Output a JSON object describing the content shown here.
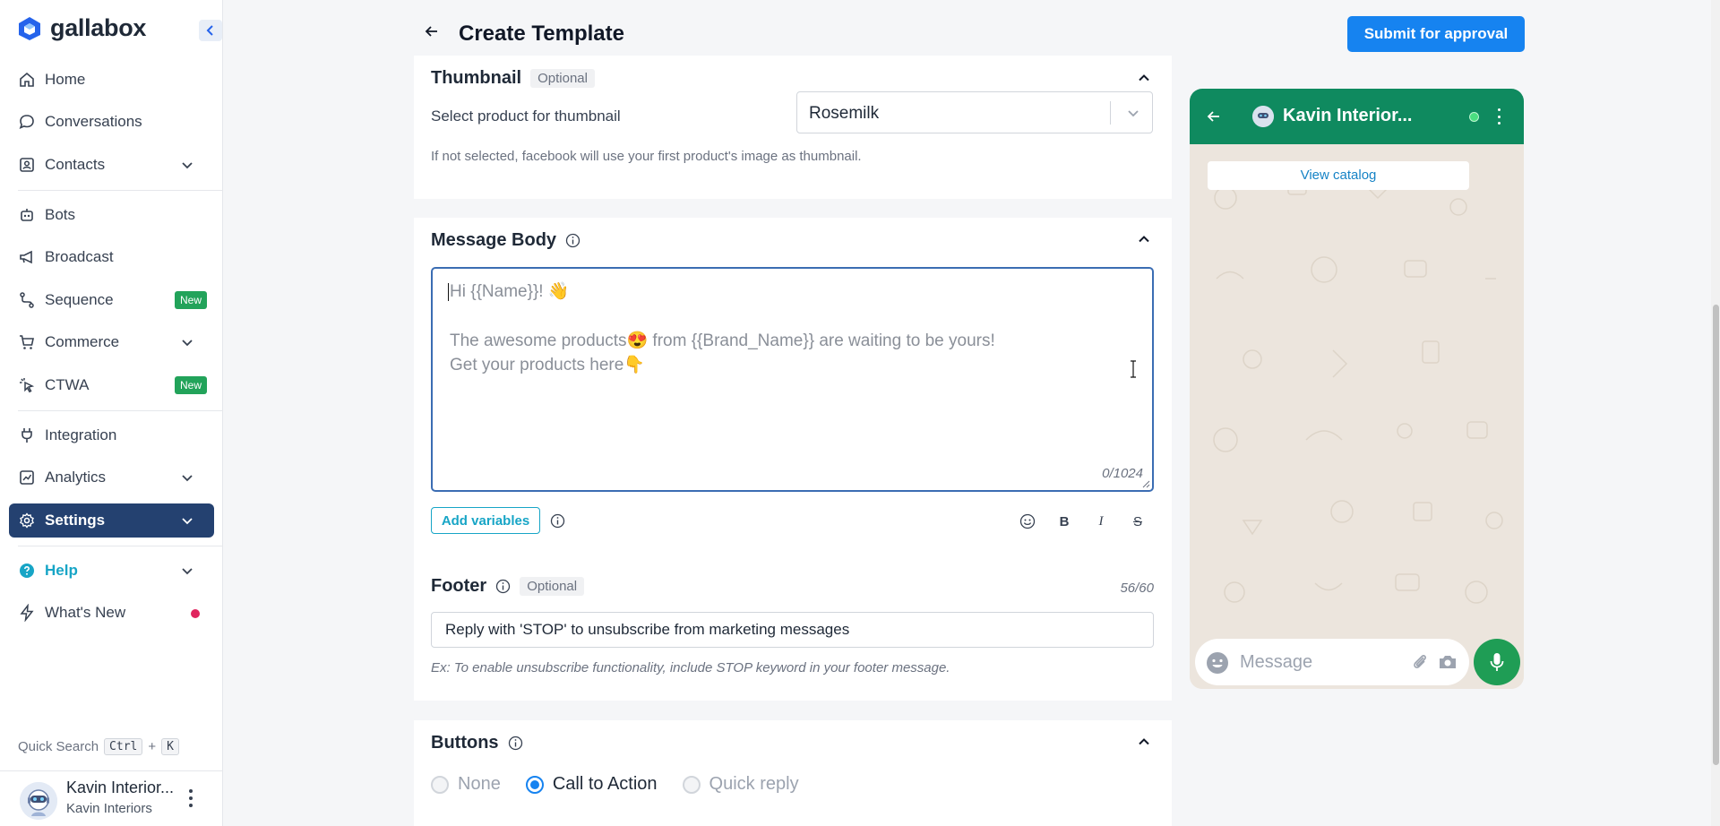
{
  "brand": {
    "name": "gallabox",
    "accent": "#1683f0",
    "logo_icon": "hexagon-cube-icon"
  },
  "sidebar": {
    "items": [
      {
        "label": "Home",
        "icon": "home-icon"
      },
      {
        "label": "Conversations",
        "icon": "chat-bubble-icon"
      },
      {
        "label": "Contacts",
        "icon": "contact-card-icon",
        "expandable": true
      },
      {
        "label": "Bots",
        "icon": "robot-icon"
      },
      {
        "label": "Broadcast",
        "icon": "megaphone-icon"
      },
      {
        "label": "Sequence",
        "icon": "flow-icon",
        "badge": "New"
      },
      {
        "label": "Commerce",
        "icon": "cart-icon",
        "expandable": true
      },
      {
        "label": "CTWA",
        "icon": "cursor-click-icon",
        "badge": "New"
      },
      {
        "label": "Integration",
        "icon": "plug-icon"
      },
      {
        "label": "Analytics",
        "icon": "chart-icon",
        "expandable": true
      },
      {
        "label": "Settings",
        "icon": "gear-icon",
        "expandable": true,
        "active": true
      },
      {
        "label": "Help",
        "icon": "help-circle-icon",
        "expandable": true
      },
      {
        "label": "What's New",
        "icon": "lightning-icon"
      }
    ],
    "quick_search": {
      "label": "Quick Search",
      "key1": "Ctrl",
      "plus": "+",
      "key2": "K"
    },
    "user": {
      "name": "Kavin Interior...",
      "org": "Kavin Interiors"
    }
  },
  "header": {
    "title": "Create Template",
    "submit_label": "Submit for approval"
  },
  "thumbnail": {
    "title": "Thumbnail",
    "optional": "Optional",
    "select_label": "Select product for thumbnail",
    "selected_value": "Rosemilk",
    "help": "If not selected, facebook will use your first product's image as thumbnail."
  },
  "message_body": {
    "title": "Message Body",
    "line1": "Hi {{Name}}! 👋",
    "line2": "",
    "line3": "The awesome products😍 from {{Brand_Name}} are waiting to be yours!",
    "line4": "Get your products here👇",
    "counter": "0/1024",
    "add_variables": "Add variables",
    "format_icons": [
      "emoji-icon",
      "bold-icon",
      "italic-icon",
      "strikethrough-icon"
    ]
  },
  "footer": {
    "title": "Footer",
    "optional": "Optional",
    "counter": "56/60",
    "value": "Reply with 'STOP' to unsubscribe from marketing messages",
    "help": "Ex: To enable unsubscribe functionality, include STOP keyword in your footer message."
  },
  "buttons": {
    "title": "Buttons",
    "options": [
      "None",
      "Call to Action",
      "Quick reply"
    ],
    "selected": "Call to Action"
  },
  "preview": {
    "contact_name": "Kavin Interior...",
    "view_catalog": "View catalog",
    "message_placeholder": "Message",
    "header_color": "#0f8a5f",
    "mic_color": "#1f9d55"
  }
}
